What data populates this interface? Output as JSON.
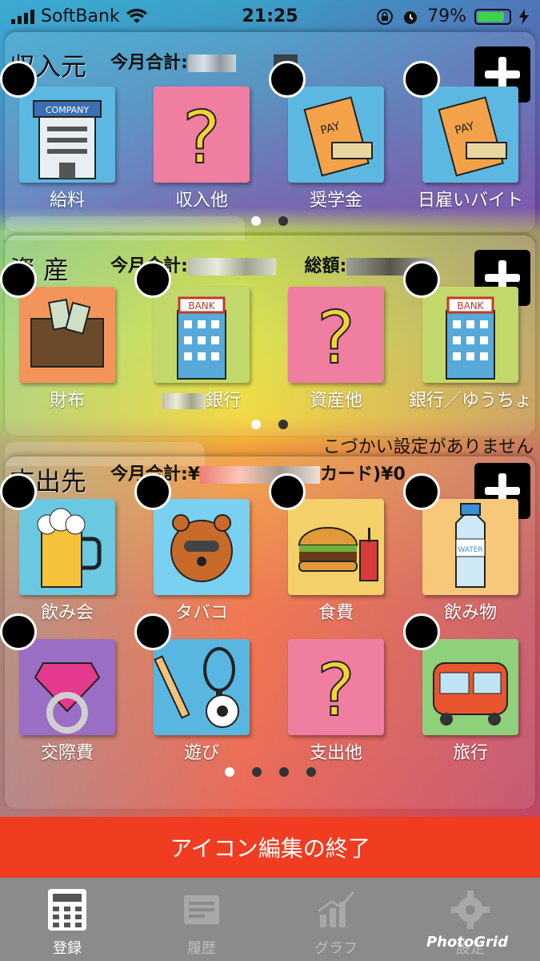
{
  "status": {
    "carrier": "SoftBank",
    "time": "21:25",
    "battery": "79%"
  },
  "income": {
    "title": "収入元",
    "total_label": "今月合計:",
    "items": [
      {
        "label": "給料",
        "icon": "company-building-icon"
      },
      {
        "label": "収入他",
        "icon": "question-icon"
      },
      {
        "label": "奨学金",
        "icon": "pay-envelope-icon"
      },
      {
        "label": "日雇いバイト",
        "icon": "pay-envelope-icon"
      }
    ]
  },
  "assets": {
    "title": "資 産",
    "total_label": "今月合計:",
    "sum_label": "総額:",
    "items": [
      {
        "label": "財布",
        "icon": "wallet-icon"
      },
      {
        "label": "銀行",
        "icon": "bank-icon"
      },
      {
        "label": "資産他",
        "icon": "question-icon"
      },
      {
        "label": "銀行／ゆうちょ",
        "icon": "bank-icon"
      }
    ]
  },
  "expense": {
    "title": "支出先",
    "total_label": "今月合計:¥",
    "card_label": "カード)¥0",
    "notice": "こづかい設定がありません",
    "items": [
      {
        "label": "飲み会",
        "icon": "beer-icon"
      },
      {
        "label": "タバコ",
        "icon": "tanuki-icon"
      },
      {
        "label": "食費",
        "icon": "burger-icon"
      },
      {
        "label": "飲み物",
        "icon": "water-bottle-icon"
      },
      {
        "label": "交際費",
        "icon": "diamond-ring-icon"
      },
      {
        "label": "遊び",
        "icon": "sports-icon"
      },
      {
        "label": "支出他",
        "icon": "question-icon"
      },
      {
        "label": "旅行",
        "icon": "train-icon"
      }
    ]
  },
  "end_button": "アイコン編集の終了",
  "tabs": [
    {
      "label": "登録",
      "icon": "calculator-icon"
    },
    {
      "label": "履歴",
      "icon": "history-icon"
    },
    {
      "label": "グラフ",
      "icon": "graph-icon"
    },
    {
      "label": "設定",
      "icon": "gear-icon"
    }
  ],
  "watermark": "PhotoGrid",
  "icon_text": {
    "company": "COMPANY",
    "pay": "PAY",
    "bank": "BANK",
    "water": "WATER"
  }
}
